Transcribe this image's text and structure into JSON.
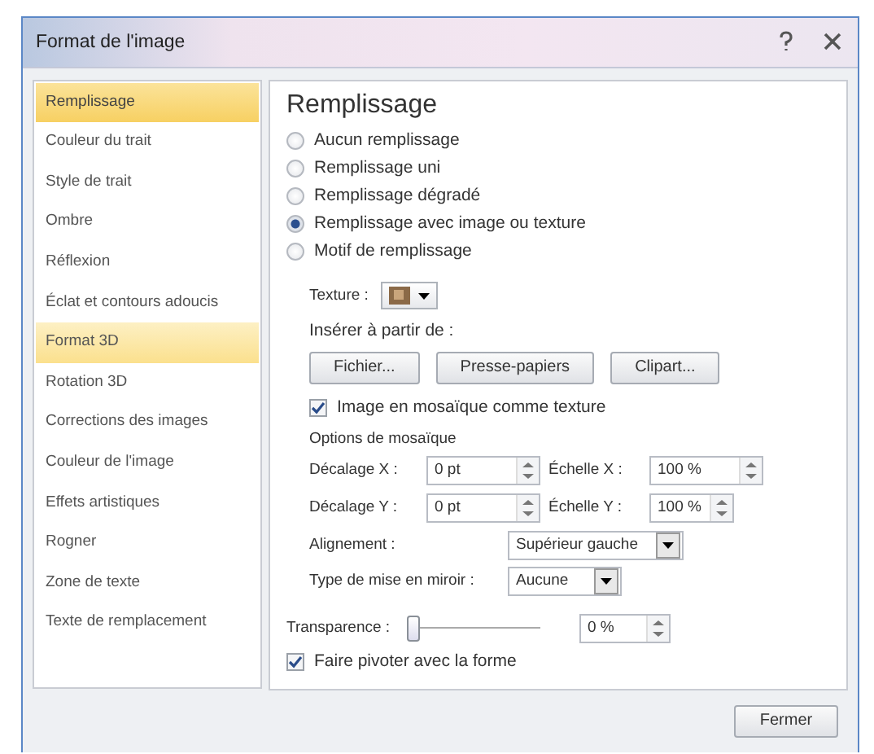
{
  "window": {
    "title": "Format de l'image"
  },
  "sidebar": {
    "items": [
      {
        "label": "Remplissage",
        "selected": true,
        "hovered": false
      },
      {
        "label": "Couleur du trait",
        "selected": false,
        "hovered": false
      },
      {
        "label": "Style de trait",
        "selected": false,
        "hovered": false
      },
      {
        "label": "Ombre",
        "selected": false,
        "hovered": false
      },
      {
        "label": "Réflexion",
        "selected": false,
        "hovered": false
      },
      {
        "label": "Éclat et contours adoucis",
        "selected": false,
        "hovered": false
      },
      {
        "label": "Format 3D",
        "selected": false,
        "hovered": true
      },
      {
        "label": "Rotation 3D",
        "selected": false,
        "hovered": false
      },
      {
        "label": "Corrections des images",
        "selected": false,
        "hovered": false
      },
      {
        "label": "Couleur de l'image",
        "selected": false,
        "hovered": false
      },
      {
        "label": "Effets artistiques",
        "selected": false,
        "hovered": false
      },
      {
        "label": "Rogner",
        "selected": false,
        "hovered": false
      },
      {
        "label": "Zone de texte",
        "selected": false,
        "hovered": false
      },
      {
        "label": "Texte de remplacement",
        "selected": false,
        "hovered": false
      }
    ]
  },
  "panel": {
    "heading": "Remplissage",
    "fill_options": [
      {
        "label": "Aucun remplissage",
        "selected": false
      },
      {
        "label": "Remplissage uni",
        "selected": false
      },
      {
        "label": "Remplissage dégradé",
        "selected": false
      },
      {
        "label": "Remplissage avec image ou texture",
        "selected": true
      },
      {
        "label": "Motif de remplissage",
        "selected": false
      }
    ],
    "texture": {
      "label": "Texture :"
    },
    "insert_from": {
      "label": "Insérer à partir de :",
      "buttons": [
        "Fichier...",
        "Presse-papiers",
        "Clipart..."
      ]
    },
    "tile_checkbox": {
      "label": "Image en mosaïque comme texture",
      "checked": true
    },
    "tiling_options": {
      "title": "Options de mosaïque",
      "fields": [
        {
          "label": "Décalage X :",
          "value": "0 pt"
        },
        {
          "label": "Échelle X :",
          "value": "100 %"
        },
        {
          "label": "Décalage Y :",
          "value": "0 pt"
        },
        {
          "label": "Échelle Y :",
          "value": "100 %"
        }
      ],
      "alignment": {
        "label": "Alignement :",
        "value": "Supérieur gauche"
      },
      "mirror": {
        "label": "Type de mise en miroir :",
        "value": "Aucune"
      }
    },
    "transparency": {
      "label": "Transparence :",
      "level": 0,
      "value": "0 %"
    },
    "rotate_checkbox": {
      "label": "Faire pivoter avec la forme",
      "checked": true
    }
  },
  "buttons": [
    "Fermer"
  ]
}
